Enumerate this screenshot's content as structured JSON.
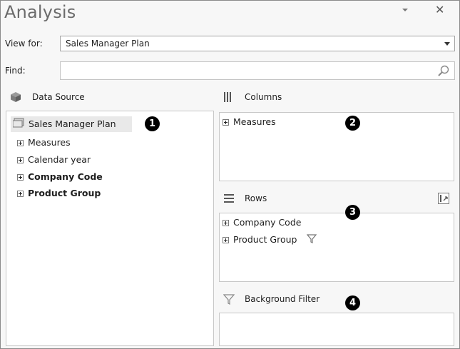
{
  "window": {
    "title": "Analysis"
  },
  "view_for": {
    "label": "View for:",
    "value": "Sales Manager Plan"
  },
  "find": {
    "label": "Find:",
    "value": "",
    "placeholder": ""
  },
  "data_source": {
    "header": "Data Source",
    "root": "Sales Manager Plan",
    "items": [
      {
        "label": "Measures",
        "bold": false
      },
      {
        "label": "Calendar year",
        "bold": false
      },
      {
        "label": "Company Code",
        "bold": true
      },
      {
        "label": "Product Group",
        "bold": true
      }
    ]
  },
  "columns": {
    "header": "Columns",
    "items": [
      "Measures"
    ]
  },
  "rows": {
    "header": "Rows",
    "items": [
      "Company Code",
      "Product Group"
    ]
  },
  "background_filter": {
    "header": "Background Filter"
  },
  "callouts": [
    "1",
    "2",
    "3",
    "4"
  ],
  "icons": {
    "title_dropdown": "dropdown-icon",
    "close": "close-icon",
    "search": "search-icon",
    "data_source": "cube-icon",
    "columns": "columns-icon",
    "rows": "rows-icon",
    "filter": "filter-icon",
    "rows_tool": "swap-axes-icon"
  }
}
